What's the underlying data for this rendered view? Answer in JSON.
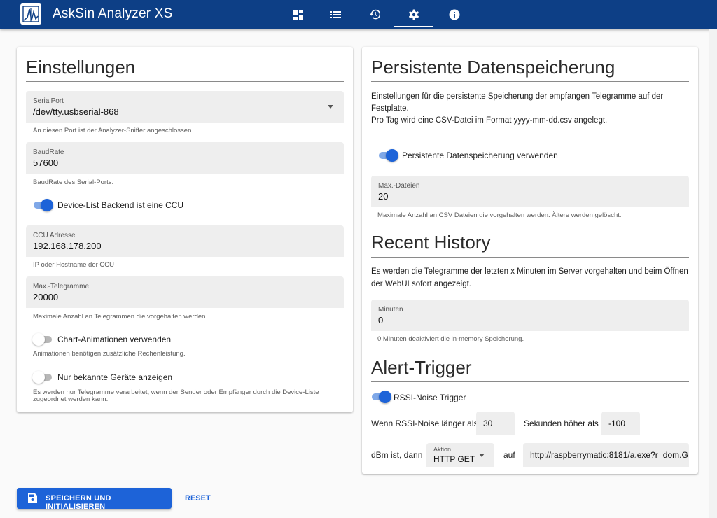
{
  "header": {
    "title": "AskSin Analyzer XS",
    "tabs": [
      {
        "icon": "dashboard-icon"
      },
      {
        "icon": "list-icon"
      },
      {
        "icon": "history-icon"
      },
      {
        "icon": "gear-icon",
        "active": true
      },
      {
        "icon": "info-icon"
      }
    ],
    "accent": "#0d3f86"
  },
  "settings": {
    "title": "Einstellungen",
    "serial_port": {
      "label": "SerialPort",
      "value": "/dev/tty.usbserial-868",
      "hint": "An diesen Port ist der Analyzer-Sniffer angeschlossen."
    },
    "baud_rate": {
      "label": "BaudRate",
      "value": "57600",
      "hint": "BaudRate des Serial-Ports."
    },
    "ccu_backend": {
      "label": "Device-List Backend ist eine CCU",
      "on": true
    },
    "ccu_address": {
      "label": "CCU Adresse",
      "value": "192.168.178.200",
      "hint": "IP oder Hostname der CCU"
    },
    "max_telegrams": {
      "label": "Max.-Telegramme",
      "value": "20000",
      "hint": "Maximale Anzahl an Telegrammen die vorgehalten werden."
    },
    "chart_animations": {
      "label": "Chart-Animationen verwenden",
      "on": false,
      "hint": "Animationen benötigen zusätzliche Rechenleistung."
    },
    "known_devices": {
      "label": "Nur bekannte Geräte anzeigen",
      "on": false,
      "hint_line1": "Es werden nur Telegramme verarbeitet, wenn der Sender oder Empfänger durch die Device-Liste",
      "hint_line2": "zugeordnet werden kann."
    }
  },
  "persistence": {
    "title": "Persistente Datenspeicherung",
    "desc_line1": "Einstellungen für die persistente Speicherung der empfangen Telegramme auf der",
    "desc_line2": "Festplatte.",
    "desc_line3": "Pro Tag wird eine CSV-Datei im Format yyyy-mm-dd.csv angelegt.",
    "enabled": {
      "label": "Persistente Datenspeicherung verwenden",
      "on": true
    },
    "max_files": {
      "label": "Max.-Dateien",
      "value": "20",
      "hint": "Maximale Anzahl an CSV Dateien die vorgehalten werden. Ältere werden gelöscht."
    }
  },
  "recent_history": {
    "title": "Recent History",
    "desc_line1": "Es werden die Telegramme der letzten x Minuten im Server vorgehalten und beim Öffnen",
    "desc_line2": "der WebUI sofort angezeigt.",
    "minutes": {
      "label": "Minuten",
      "value": "0",
      "hint": "0 Minuten deaktiviert die in-memory Speicherung."
    }
  },
  "alert_trigger": {
    "title": "Alert-Trigger",
    "rssi_noise": {
      "label": "RSSI-Noise Trigger",
      "on": true
    },
    "text_longer": "Wenn RSSI-Noise länger als",
    "seconds_value": "30",
    "text_seconds": "Sekunden höher als",
    "dbm_value": "-100",
    "text_dbm": "dBm ist, dann",
    "action": {
      "label": "Aktion",
      "value": "HTTP GET"
    },
    "text_auf": "auf",
    "url_value": "http://raspberrymatic:8181/a.exe?r=dom.G"
  },
  "actions": {
    "save_label": "SPEICHERN UND INITIALISIEREN",
    "reset_label": "RESET",
    "primary_color": "#1d63d8"
  }
}
